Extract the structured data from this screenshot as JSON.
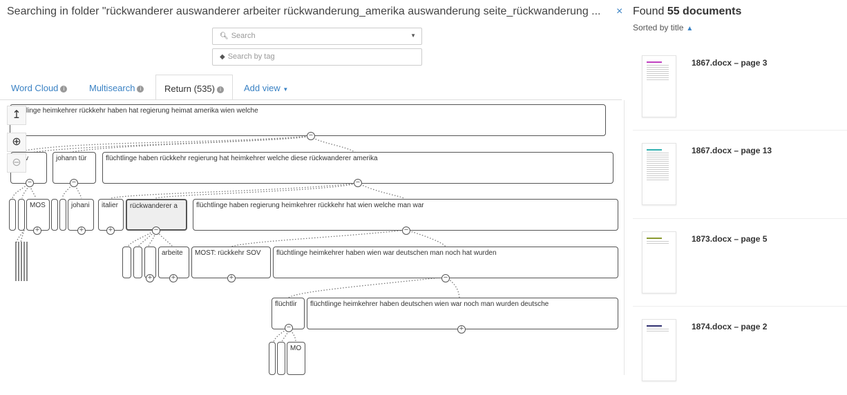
{
  "header": {
    "title": "Searching in folder \"rückwanderer auswanderer arbeiter rückwanderung_amerika auswanderung seite_rückwanderung ...",
    "close": "×",
    "found_prefix": "Found ",
    "found_count": "55 documents",
    "sorted_by": "Sorted by title"
  },
  "search": {
    "placeholder": "Search",
    "tag_placeholder": "Search by tag"
  },
  "tabs": [
    {
      "label": "Word Cloud",
      "active": false
    },
    {
      "label": "Multisearch",
      "active": false
    },
    {
      "label": "Return (535)",
      "active": true
    }
  ],
  "add_view": "Add view",
  "icons": {
    "search": "search-icon",
    "tag": "tag-icon",
    "dropdown": "caret-down-icon",
    "info": "info-icon",
    "up": "arrow-up-icon",
    "zoom_in": "zoom-in-icon",
    "zoom_out": "zoom-out-icon",
    "sort": "caret-up-icon"
  },
  "tree": {
    "nodes": [
      {
        "id": "n1",
        "label": "üchtlinge heimkehrer rückkehr haben hat regierung heimat amerika wien welche"
      },
      {
        "id": "n2",
        "label": "ausv"
      },
      {
        "id": "n3",
        "label": "johann tür"
      },
      {
        "id": "n4",
        "label": "flüchtlinge haben rückkehr regierung hat heimkehrer welche diese rückwanderer amerika"
      },
      {
        "id": "n5",
        "label": "MOS"
      },
      {
        "id": "n6",
        "label": "johani"
      },
      {
        "id": "n7",
        "label": "italier"
      },
      {
        "id": "n8",
        "label": "rückwanderer a"
      },
      {
        "id": "n9",
        "label": "flüchtlinge haben regierung heimkehrer rückkehr hat wien welche man war"
      },
      {
        "id": "n10",
        "label": "arbeite"
      },
      {
        "id": "n11",
        "label": "MOST: rückkehr SOV"
      },
      {
        "id": "n12",
        "label": "flüchtlinge heimkehrer haben wien war deutschen man noch hat wurden"
      },
      {
        "id": "n13",
        "label": "flüchtlir"
      },
      {
        "id": "n14",
        "label": "flüchtlinge heimkehrer haben deutschen wien war noch man wurden deutsche"
      },
      {
        "id": "n15",
        "label": "MO"
      }
    ],
    "collapse_glyph": "−",
    "expand_glyph": "+"
  },
  "results": [
    {
      "title": "1867.docx – page 3",
      "accent": "#c040c0"
    },
    {
      "title": "1867.docx – page 13",
      "accent": "#30b0b0"
    },
    {
      "title": "1873.docx – page 5",
      "accent": "#8a9a30"
    },
    {
      "title": "1874.docx – page 2",
      "accent": "#303070"
    }
  ],
  "colors": {
    "link": "#3a82c4",
    "border": "#555555"
  }
}
